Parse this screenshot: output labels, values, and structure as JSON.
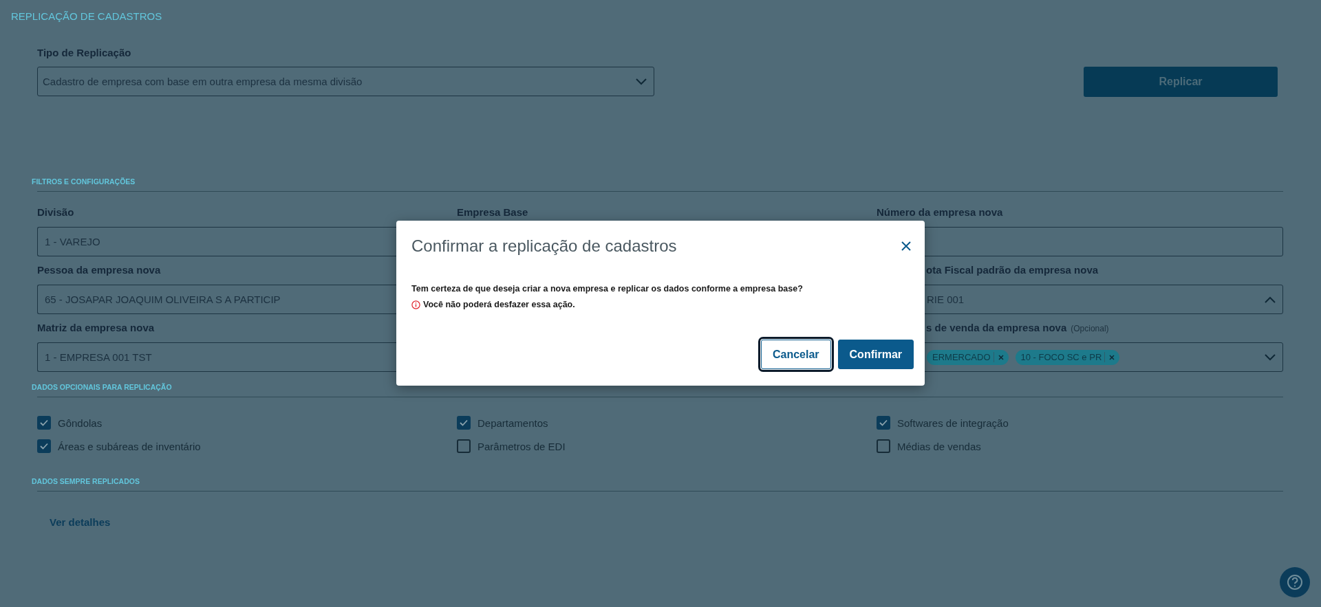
{
  "page_title": "REPLICAÇÃO DE CADASTROS",
  "replication_type": {
    "label": "Tipo de Replicação",
    "value": "Cadastro de empresa com base em outra empresa da mesma divisão"
  },
  "replicate_button": {
    "label": "Replicar",
    "disabled": true
  },
  "filters": {
    "heading": "FILTROS E CONFIGURAÇÕES",
    "columns": [
      {
        "fields": [
          {
            "label": "Divisão",
            "kind": "input",
            "value": "1 - VAREJO"
          },
          {
            "label": "Pessoa da empresa nova",
            "kind": "input",
            "value": "65 - JOSAPAR JOAQUIM OLIVEIRA S A PARTICIP"
          },
          {
            "label": "Matriz da empresa nova",
            "kind": "input",
            "value": "1 - EMPRESA 001 TST"
          }
        ]
      },
      {
        "fields": [
          {
            "label": "Empresa Base",
            "kind": "label"
          }
        ]
      },
      {
        "fields": [
          {
            "label": "Número da empresa nova",
            "kind": "input"
          },
          {
            "label": "ota Fiscal padrão da empresa nova",
            "kind": "dropdown",
            "value": "RIE 001",
            "expanded": true,
            "covered": true
          },
          {
            "label": "s de venda da empresa nova",
            "hint": "(Opcional)",
            "kind": "multiselect",
            "tags": [
              "ERMERCADO",
              "10 - FOCO SC e PR"
            ],
            "expanded": false,
            "covered": true
          }
        ]
      }
    ]
  },
  "optional_data": {
    "heading": "DADOS OPCIONAIS PARA REPLICAÇÃO",
    "items": [
      {
        "label": "Gôndolas",
        "checked": true
      },
      {
        "label": "Departamentos",
        "checked": true
      },
      {
        "label": "Softwares de integração",
        "checked": true
      },
      {
        "label": "Áreas e subáreas de inventário",
        "checked": true
      },
      {
        "label": "Parâmetros de EDI",
        "checked": false
      },
      {
        "label": "Médias de vendas",
        "checked": false
      }
    ]
  },
  "always_replicated": {
    "heading": "DADOS SEMPRE REPLICADOS",
    "link": "Ver detalhes"
  },
  "dialog": {
    "title": "Confirmar a replicação de cadastros",
    "message": "Tem certeza de que deseja criar a nova empresa e replicar os dados conforme a empresa base?",
    "warning": "Você não poderá desfazer essa ação.",
    "buttons": [
      {
        "label": "Cancelar",
        "kind": "secondary",
        "focused": true
      },
      {
        "label": "Confirmar",
        "kind": "primary",
        "focused": false
      }
    ]
  }
}
